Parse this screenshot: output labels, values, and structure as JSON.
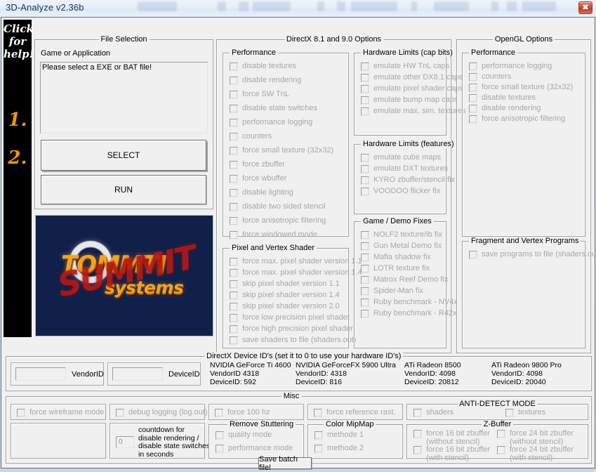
{
  "window": {
    "title": "3D-Analyze v2.36b",
    "close_label": "✖"
  },
  "helpbar": {
    "line1": "Click",
    "line2": "for",
    "line3": "help!",
    "step1": "1.",
    "step2": "2."
  },
  "file_selection": {
    "title": "File Selection",
    "label": "Game or Application",
    "field_value": "Please select a EXE or BAT file!",
    "select_button": "SELECT",
    "run_button": "RUN"
  },
  "logo": {
    "brand": "TOMMTI",
    "brand_sub": "systems",
    "overlay": "SUMMIT"
  },
  "directx": {
    "title": "DirectX 8.1 and 9.0 Options",
    "performance": {
      "title": "Performance",
      "items": [
        "disable textures",
        "disable rendering",
        "force SW TnL",
        "disable state switches",
        "performance logging",
        "counters",
        "force small texture (32x32)",
        "force zbuffer",
        "force wbuffer",
        "disable lighting",
        "disable two sided stencil",
        "force anisotropic filtering",
        "force windowed mode"
      ]
    },
    "pixel_vertex_shader": {
      "title": "Pixel and Vertex Shader",
      "items": [
        "force max. pixel shader version 1.1",
        "force max. pixel shader version 1.4",
        "skip pixel shader version 1.1",
        "skip pixel shader version 1.4",
        "skip pixel shader version 2.0",
        "force low precision pixel shader",
        "force high precision pixel shader",
        "save shaders to file (shaders.out)"
      ]
    },
    "hardware_limits_cap_bits": {
      "title": "Hardware Limits (cap bits)",
      "items": [
        "emulate HW TnL caps",
        "emulate other DX8.1 caps",
        "emulate pixel shader caps",
        "emulate bump map caps",
        "emulate max. sim. textures"
      ]
    },
    "hardware_limits_features": {
      "title": "Hardware Limits (features)",
      "items": [
        "emulate cube maps",
        "emulate DXT textures",
        "KYRO zbuffer/stencil fix",
        "VOODOO flicker fix"
      ]
    },
    "game_demo_fixes": {
      "title": "Game / Demo Fixes",
      "items": [
        "NOLF2 texture/ib fix",
        "Gun Metal Demo fix",
        "Mafia shadow fix",
        "LOTR texture fix",
        "Matrox Reef Demo fix",
        "Spider-Man fix",
        "Ruby benchmark - NV4x",
        "Ruby benchmark - R42x"
      ]
    }
  },
  "opengl": {
    "title": "OpenGL Options",
    "performance": {
      "title": "Performance",
      "items": [
        "performance logging",
        "counters",
        "force small texture (32x32)",
        "disable textures",
        "disable rendering",
        "force anisotropic filtering"
      ]
    },
    "fragment_vertex_programs": {
      "title": "Fragment and Vertex Programs",
      "items": [
        "save programs to file (shaders.out)"
      ]
    }
  },
  "device_ids": {
    "title": "DirectX Device ID's (set it to 0 to use your hardware ID's)",
    "vendor_label": "VendorID",
    "device_label": "DeviceID",
    "vendor_value": "",
    "device_value": "",
    "cards": [
      {
        "name": "NVIDIA GeForce Ti 4600",
        "vendor": "VendorID 4318",
        "device": "DeviceID: 592"
      },
      {
        "name": "NVIDIA GeForceFX 5900 Ultra",
        "vendor": "VendorID: 4318",
        "device": "DeviceID: 816"
      },
      {
        "name": "ATi Radeon 8500",
        "vendor": "VendorID: 4098",
        "device": "DeviceID: 20812"
      },
      {
        "name": "ATi Radeon 9800 Pro",
        "vendor": "VendorID: 4098",
        "device": "DeviceID: 20040"
      }
    ]
  },
  "misc": {
    "title": "Misc",
    "force_wireframe": "force wireframe mode",
    "debug_logging": "debug logging (log.out)",
    "force_100hz": "force 100 hz",
    "force_reference_rast": "force reference rast.",
    "countdown_value": "0",
    "countdown_lines": [
      "countdown for",
      "disable rendering /",
      "disable state switches",
      "in seconds"
    ],
    "remove_stuttering": {
      "title": "Remove Stuttering",
      "items": [
        "quality mode",
        "performance mode"
      ]
    },
    "color_mipmap": {
      "title": "Color MipMap",
      "items": [
        "methode 1",
        "methode 2"
      ]
    },
    "anti_detect": {
      "title": "ANTI-DETECT MODE",
      "items": [
        "shaders",
        "textures"
      ]
    },
    "zbuffer": {
      "title": "Z-Buffer",
      "items": [
        {
          "l1": "force 16 bit zbuffer",
          "l2": "(without stencil)"
        },
        {
          "l1": "force 16 bit zbuffer",
          "l2": "(with stencil)"
        },
        {
          "l1": "force 24 bit zbuffer",
          "l2": "(without stencil)"
        },
        {
          "l1": "force 24 bit zbuffer",
          "l2": "(with stencil)"
        }
      ]
    }
  },
  "save_batch_button": "Save batch file!"
}
